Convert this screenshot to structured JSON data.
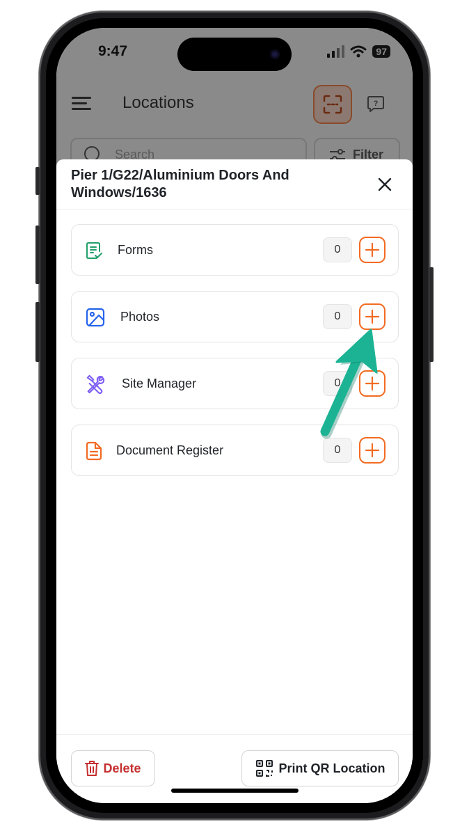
{
  "status_bar": {
    "time": "9:47",
    "battery": "97"
  },
  "background_app": {
    "title": "Locations",
    "search_placeholder": "Search",
    "filter_label": "Filter"
  },
  "sheet": {
    "title": "Pier 1/G22/Aluminium Doors And Windows/1636",
    "items": [
      {
        "label": "Forms",
        "count": "0",
        "icon": "form-check-icon",
        "color": "#22a06b"
      },
      {
        "label": "Photos",
        "count": "0",
        "icon": "image-icon",
        "color": "#2563eb"
      },
      {
        "label": "Site Manager",
        "count": "0",
        "icon": "tools-icon",
        "color": "#7c5cf5"
      },
      {
        "label": "Document Register",
        "count": "0",
        "icon": "document-icon",
        "color": "#f26b22"
      }
    ]
  },
  "footer": {
    "delete_label": "Delete",
    "print_label": "Print QR Location"
  },
  "colors": {
    "accent": "#f26b22",
    "danger": "#c42f2f",
    "annotation": "#1bb394"
  }
}
